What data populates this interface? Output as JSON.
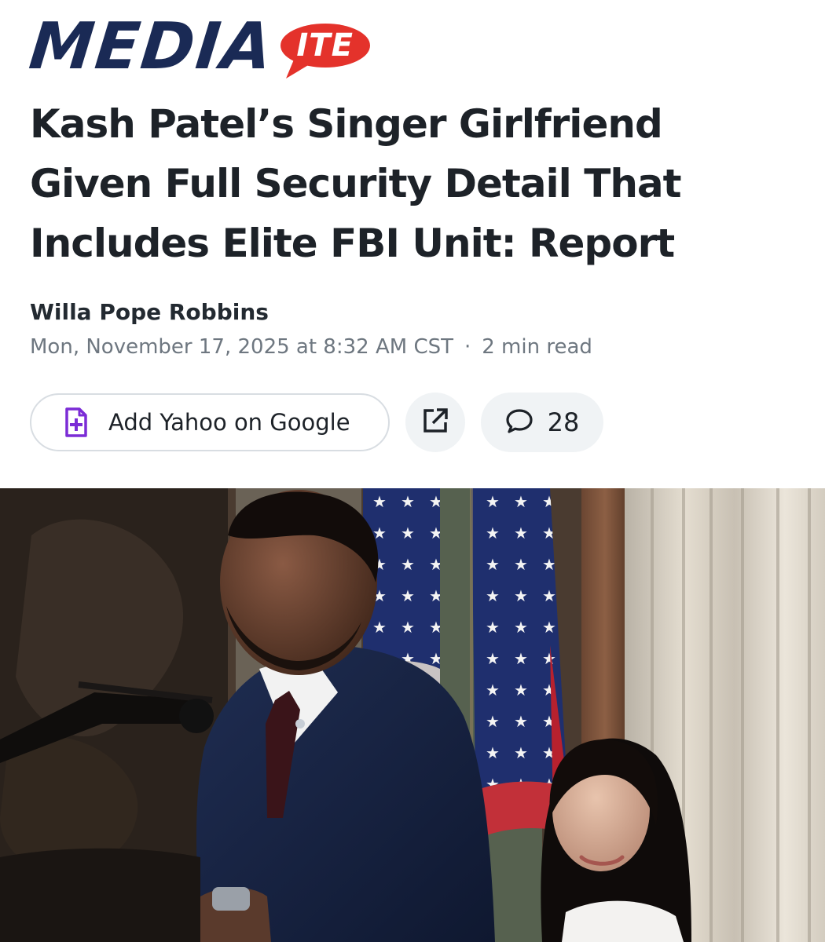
{
  "publication": {
    "logo_main": "MEDIA",
    "logo_badge": "ITE"
  },
  "article": {
    "headline": "Kash Patel’s Singer Girlfriend Given Full Security Detail That Includes Elite FBI Unit: Report",
    "author": "Willa Pope Robbins",
    "timestamp": "Mon, November 17, 2025 at 8:32 AM CST",
    "separator": "·",
    "read_time": "2 min read"
  },
  "actions": {
    "add_google_label": "Add Yahoo on Google",
    "add_google_icon": "add-document-icon",
    "share_icon": "external-share-icon",
    "comment_icon": "comment-bubble-icon",
    "comment_count": "28"
  },
  "colors": {
    "logo_navy": "#1a2a55",
    "logo_red": "#e4322b",
    "accent_purple": "#7b2cd6",
    "meta_gray": "#6e7780"
  }
}
